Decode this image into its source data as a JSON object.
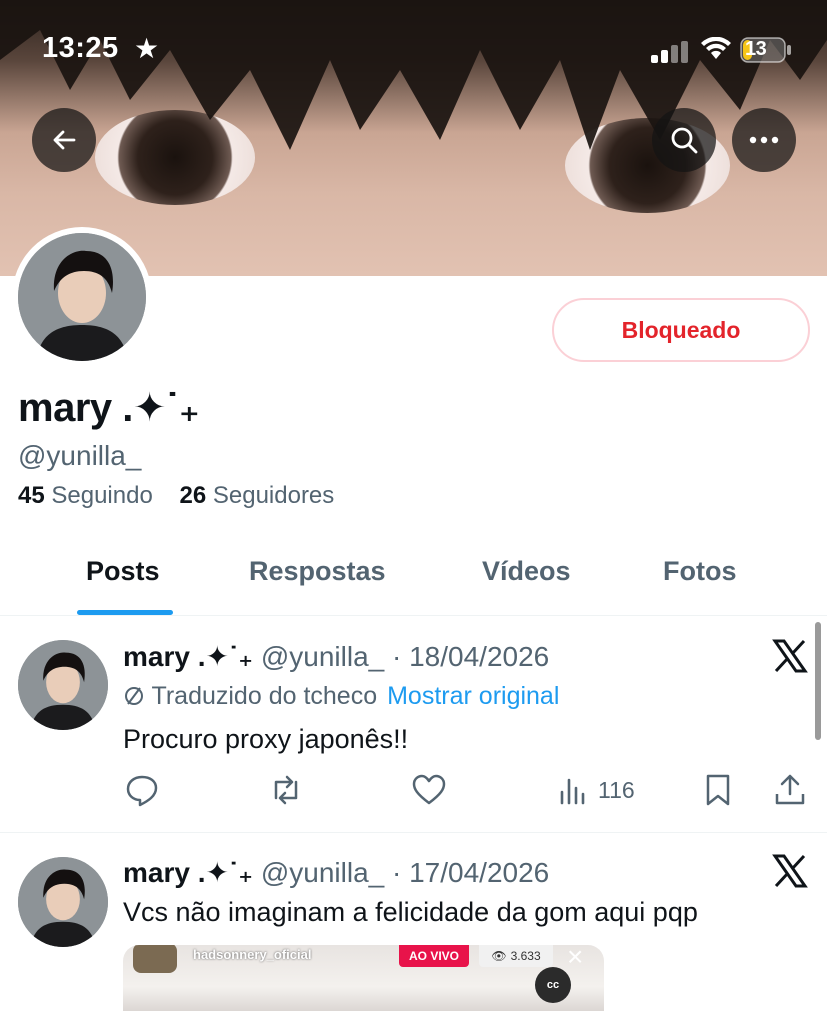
{
  "status_bar": {
    "time": "13:25",
    "battery": "13"
  },
  "profile": {
    "display_name": "mary .✦˙₊",
    "handle": "@yunilla_",
    "following_count": "45",
    "following_label": "Seguindo",
    "followers_count": "26",
    "followers_label": "Seguidores",
    "blocked_label": "Bloqueado"
  },
  "tabs": [
    {
      "label": "Posts",
      "active": true
    },
    {
      "label": "Respostas",
      "active": false
    },
    {
      "label": "Vídeos",
      "active": false
    },
    {
      "label": "Fotos",
      "active": false
    }
  ],
  "posts": [
    {
      "name": "mary .✦˙₊",
      "meta": "@yunilla_ · 18/04/2026",
      "translated_label": "Traduzido do tcheco",
      "show_original": "Mostrar original",
      "text": "Procuro proxy japonês!!",
      "views": "116"
    },
    {
      "name": "mary .✦˙₊",
      "meta": "@yunilla_ · 17/04/2026",
      "text": "Vcs não imaginam a felicidade da gom aqui pqp",
      "media": {
        "username": "hadsonnery_oficial",
        "live_label": "AO VIVO",
        "viewers": "3.633",
        "cc_label": "cc"
      }
    }
  ],
  "colors": {
    "accent": "#1d9bf0",
    "blocked": "#e3242b",
    "muted": "#536471"
  }
}
